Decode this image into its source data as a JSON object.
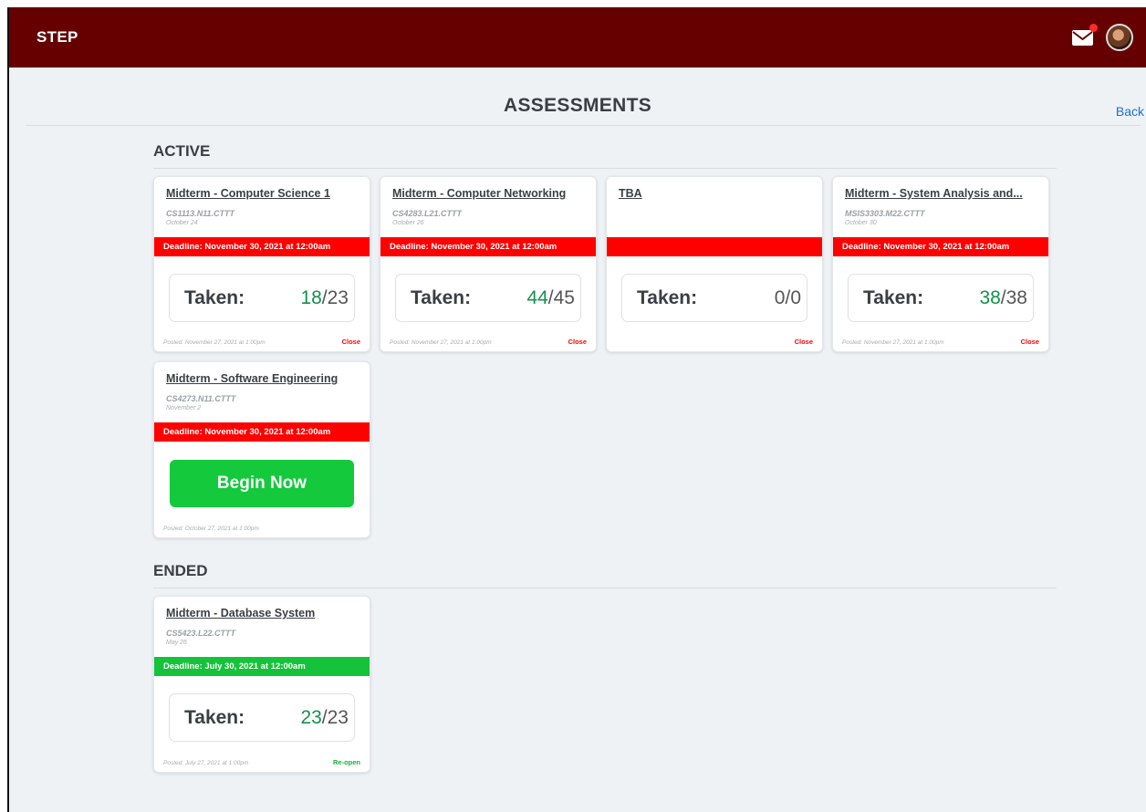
{
  "app": {
    "brand": "STEP"
  },
  "header": {
    "title": "ASSESSMENTS",
    "back_label": "Back"
  },
  "colors": {
    "topbar": "#660000",
    "deadline_active": "#ff0000",
    "deadline_ended": "#15c33a",
    "taken_count": "#12924a",
    "back_link": "#1a6fd6"
  },
  "icons": {
    "mail": "envelope-icon",
    "notification": "notification-dot",
    "profile": "avatar"
  },
  "sections": {
    "active": {
      "label": "ACTIVE",
      "cards": [
        {
          "title": "Midterm - Computer Science 1",
          "code": "CS1113.N11.CTTT",
          "date": "October 24",
          "deadline": "Deadline: November 30, 2021 at 12:00am",
          "taken_label": "Taken:",
          "taken": "18",
          "total": "/23",
          "posted": "Posted: November 27, 2021 at 1:00pm",
          "action": "Close"
        },
        {
          "title": "Midterm - Computer Networking",
          "code": "CS4283.L21.CTTT",
          "date": "October 26",
          "deadline": "Deadline: November 30, 2021 at 12:00am",
          "taken_label": "Taken:",
          "taken": "44",
          "total": "/45",
          "posted": "Posted: November 27, 2021 at 1:00pm",
          "action": "Close"
        },
        {
          "title": "TBA",
          "code": "",
          "date": "",
          "deadline": "",
          "taken_label": "Taken:",
          "taken": "0",
          "total": "/0",
          "posted": "",
          "action": "Close"
        },
        {
          "title": "Midterm - System Analysis and...",
          "code": "MSIS3303.M22.CTTT",
          "date": "October 30",
          "deadline": "Deadline: November 30, 2021 at 12:00am",
          "taken_label": "Taken:",
          "taken": "38",
          "total": "/38",
          "posted": "Posted: November 27, 2021 at 1:00pm",
          "action": "Close"
        },
        {
          "title": "Midterm - Software Engineering",
          "code": "CS4273.N11.CTTT",
          "date": "November 2",
          "deadline": "Deadline: November 30, 2021 at 12:00am",
          "button": "Begin Now",
          "posted": "Posted: October 27, 2021 at 1:00pm"
        }
      ]
    },
    "ended": {
      "label": "ENDED",
      "cards": [
        {
          "title": "Midterm - Database System",
          "code": "CS5423.L22.CTTT",
          "date": "May 26",
          "deadline": "Deadline: July 30, 2021 at 12:00am",
          "taken_label": "Taken:",
          "taken": "23",
          "total": "/23",
          "posted": "Posted: July 27, 2021 at 1:00pm",
          "action": "Re-open"
        }
      ]
    }
  }
}
